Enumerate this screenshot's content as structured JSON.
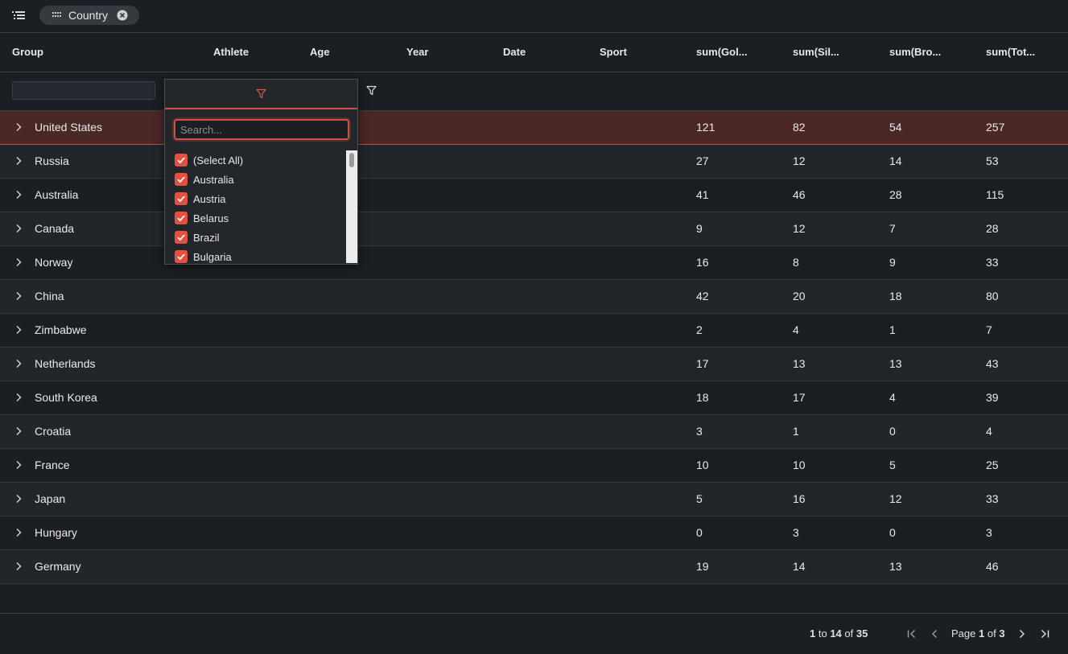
{
  "toolbar": {
    "icons": {
      "menu": "list-menu-icon",
      "grip": "grip-icon",
      "remove": "close-circle-icon"
    },
    "group_pill_label": "Country"
  },
  "columns": [
    "Group",
    "Athlete",
    "Age",
    "Year",
    "Date",
    "Sport",
    "sum(Gol...",
    "sum(Sil...",
    "sum(Bro...",
    "sum(Tot..."
  ],
  "filter_popup": {
    "search_placeholder": "Search...",
    "options": [
      "(Select All)",
      "Australia",
      "Austria",
      "Belarus",
      "Brazil",
      "Bulgaria"
    ],
    "all_checked": true
  },
  "rows": [
    {
      "group": "United States",
      "gold": "121",
      "silver": "82",
      "bronze": "54",
      "total": "257"
    },
    {
      "group": "Russia",
      "gold": "27",
      "silver": "12",
      "bronze": "14",
      "total": "53"
    },
    {
      "group": "Australia",
      "gold": "41",
      "silver": "46",
      "bronze": "28",
      "total": "115"
    },
    {
      "group": "Canada",
      "gold": "9",
      "silver": "12",
      "bronze": "7",
      "total": "28"
    },
    {
      "group": "Norway",
      "gold": "16",
      "silver": "8",
      "bronze": "9",
      "total": "33"
    },
    {
      "group": "China",
      "gold": "42",
      "silver": "20",
      "bronze": "18",
      "total": "80"
    },
    {
      "group": "Zimbabwe",
      "gold": "2",
      "silver": "4",
      "bronze": "1",
      "total": "7"
    },
    {
      "group": "Netherlands",
      "gold": "17",
      "silver": "13",
      "bronze": "13",
      "total": "43"
    },
    {
      "group": "South Korea",
      "gold": "18",
      "silver": "17",
      "bronze": "4",
      "total": "39"
    },
    {
      "group": "Croatia",
      "gold": "3",
      "silver": "1",
      "bronze": "0",
      "total": "4"
    },
    {
      "group": "France",
      "gold": "10",
      "silver": "10",
      "bronze": "5",
      "total": "25"
    },
    {
      "group": "Japan",
      "gold": "5",
      "silver": "16",
      "bronze": "12",
      "total": "33"
    },
    {
      "group": "Hungary",
      "gold": "0",
      "silver": "3",
      "bronze": "0",
      "total": "3"
    },
    {
      "group": "Germany",
      "gold": "19",
      "silver": "14",
      "bronze": "13",
      "total": "46"
    }
  ],
  "pagination": {
    "from": "1",
    "to_word": "to",
    "to": "14",
    "of_word": "of",
    "total": "35",
    "page_word": "Page",
    "page": "1",
    "of_word2": "of",
    "pages": "3"
  },
  "colors": {
    "accent": "#e4513f",
    "background": "#1b1f24",
    "selected_row": "#4a2826"
  }
}
